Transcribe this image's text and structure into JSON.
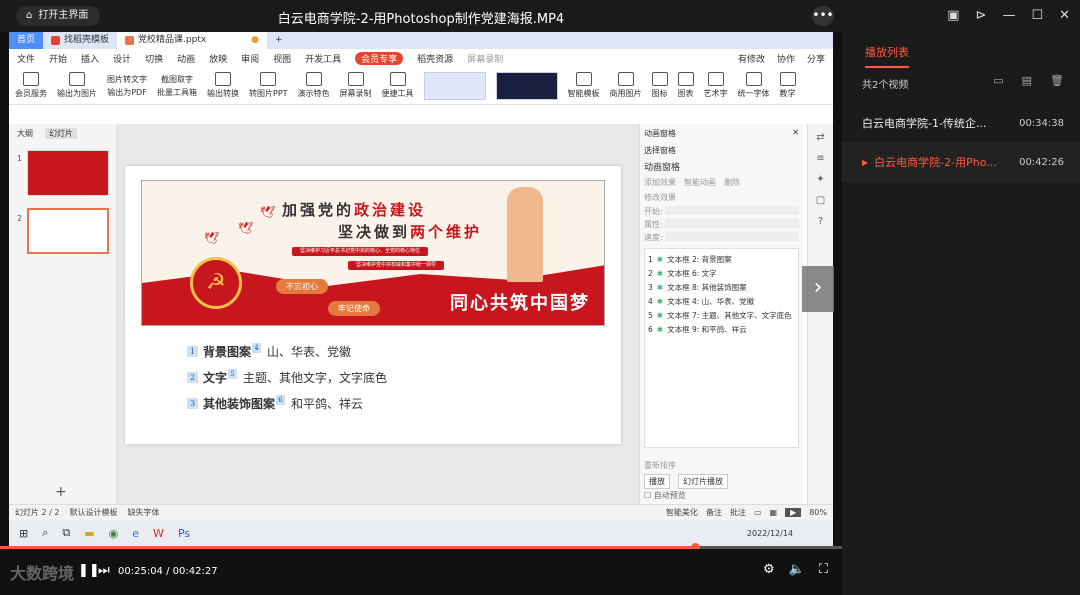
{
  "player": {
    "home_button": "打开主界面",
    "title": "白云电商学院-2-用Photoshop制作党建海报.MP4",
    "more": "•••",
    "time_current": "00:25:04",
    "time_total": "00:42:27",
    "time_sep": " / ",
    "progress": 0.826,
    "brand": "大数跨境"
  },
  "playlist": {
    "tab": "播放列表",
    "count": "共2个视频",
    "items": [
      {
        "name": "白云电商学院-1-传统企...",
        "duration": "00:34:38"
      },
      {
        "name": "白云电商学院-2-用Pho...",
        "duration": "00:42:26"
      }
    ]
  },
  "wps": {
    "tabs": {
      "home": "首页",
      "find": "找稻壳模板",
      "doc": "党校精品课.pptx"
    },
    "menu": [
      "文件",
      "开始",
      "插入",
      "设计",
      "切换",
      "动画",
      "放映",
      "审阅",
      "视图",
      "开发工具"
    ],
    "menu_vip": "会员专享",
    "menu_extra": "稻壳资源",
    "menu_search": "屏幕录制",
    "menu_right": [
      "有修改",
      "协作",
      "分享"
    ],
    "ribbon": [
      "会员服务",
      "输出为图片",
      "图片转文字",
      "截图取字",
      "批量工具箱",
      "输出转换",
      "转图片PPT",
      "演示特色",
      "屏幕录制",
      "便捷工具",
      "智能模板",
      "商用图片",
      "图标",
      "图表",
      "艺术字",
      "统一字体",
      "教学"
    ],
    "ribbon_pdf": "输出为PDF",
    "left_tabs": [
      "大纲",
      "幻灯片"
    ],
    "slide_nums": [
      "1",
      "2"
    ],
    "add_slide": "+",
    "banner": {
      "line1_a": "加强党的",
      "line1_b": "政治建设",
      "line2_a": "坚决做到",
      "line2_b": "两个维护",
      "pill1": "坚决维护习近平总书记党中央的核心、全党的核心地位",
      "pill2": "坚决维护党中央权威和集中统一领导",
      "tag1": "不忘初心",
      "tag2": "牢记使命",
      "slogan": "同心共筑中国梦"
    },
    "bullets": [
      {
        "num": "1",
        "key": "背景图案",
        "sup": "4",
        "text": "山、华表、党徽"
      },
      {
        "num": "2",
        "key": "文字",
        "sup": "5",
        "text": "主题、其他文字，文字底色"
      },
      {
        "num": "3",
        "key": "其他装饰图案",
        "sup": "6",
        "text": "和平鸽、祥云"
      }
    ],
    "anim": {
      "header": "动画窗格",
      "select_pane": "选择窗格",
      "title": "动画窗格",
      "add_effect": "添加效果",
      "smart_anim": "智能动画",
      "delete": "删除",
      "modify": "修改效果",
      "fields": [
        "开始:",
        "属性:",
        "速度:"
      ],
      "items": [
        {
          "n": "1",
          "t": "文本框 2: 背景图案"
        },
        {
          "n": "2",
          "t": "文本框 6: 文字"
        },
        {
          "n": "3",
          "t": "文本框 8: 其他装饰图案"
        },
        {
          "n": "4",
          "t": "文本框 4: 山、华表、党徽"
        },
        {
          "n": "5",
          "t": "文本框 7: 主题、其他文字、文字底色"
        },
        {
          "n": "6",
          "t": "文本框 9: 和平鸽、祥云"
        }
      ],
      "reorder": "重新排序",
      "play": "播放",
      "slideshow": "幻灯片播放",
      "autopreview": "自动预览"
    },
    "status": {
      "slide": "幻灯片 2 / 2",
      "template": "默认设计模板",
      "font": "缺失字体",
      "beautify": "智能美化",
      "notes": "备注",
      "comment": "批注",
      "zoom": "80%"
    },
    "taskbar_date": "2022/12/14"
  }
}
